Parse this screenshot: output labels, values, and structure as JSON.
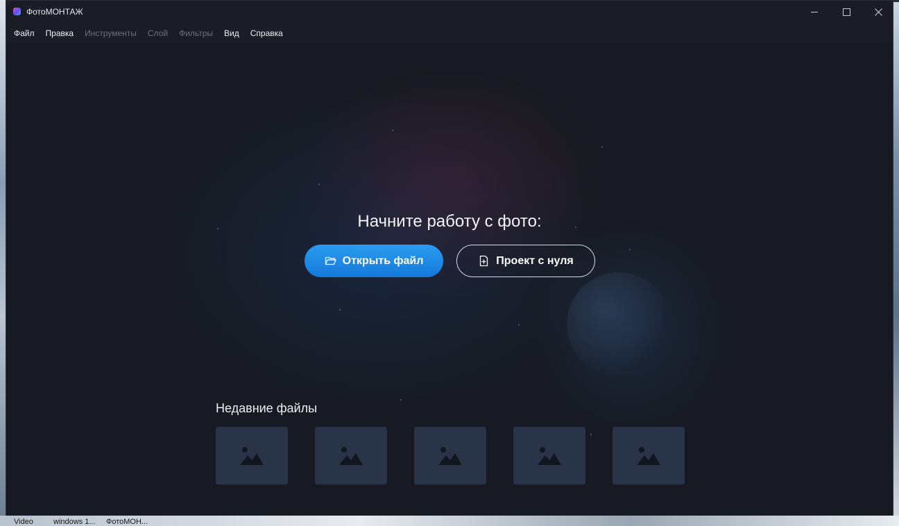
{
  "window": {
    "title": "ФотоМОНТАЖ"
  },
  "menu": [
    {
      "label": "Файл",
      "enabled": true
    },
    {
      "label": "Правка",
      "enabled": true
    },
    {
      "label": "Инструменты",
      "enabled": false
    },
    {
      "label": "Слой",
      "enabled": false
    },
    {
      "label": "Фильтры",
      "enabled": false
    },
    {
      "label": "Вид",
      "enabled": true
    },
    {
      "label": "Справка",
      "enabled": true
    }
  ],
  "start": {
    "heading": "Начните работу с фото:",
    "open_button": "Открыть файл",
    "new_button": "Проект с нуля"
  },
  "recent": {
    "title": "Недавние файлы",
    "thumbnails": [
      "image-placeholder",
      "image-placeholder",
      "image-placeholder",
      "image-placeholder",
      "image-placeholder"
    ]
  },
  "taskbar": {
    "items": [
      "Video",
      "windows 1...",
      "ФотоМОН..."
    ]
  },
  "colors": {
    "window_bg": "#1a1d25",
    "accent_button": "#1f8ae6",
    "thumb_bg": "#2a3448",
    "disabled_text": "#6b707c"
  }
}
